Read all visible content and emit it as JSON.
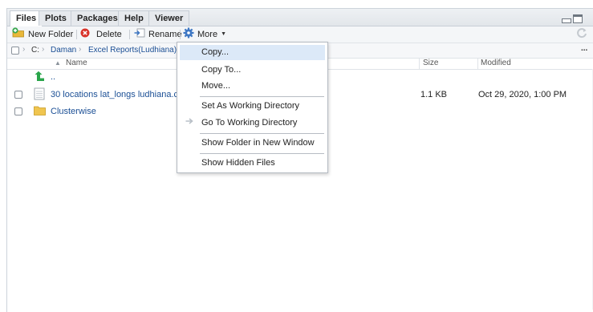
{
  "tabs": [
    "Files",
    "Plots",
    "Packages",
    "Help",
    "Viewer"
  ],
  "toolbar": {
    "new_folder": "New Folder",
    "delete": "Delete",
    "rename": "Rename",
    "more": "More"
  },
  "path": {
    "root": "C:",
    "crumbs": [
      "Daman",
      "Excel Reports(Ludhiana)"
    ],
    "more_label": "..."
  },
  "columns": {
    "name": "Name",
    "size": "Size",
    "modified": "Modified"
  },
  "files": {
    "parent": "..",
    "rows": [
      {
        "name": "30 locations lat_longs ludhiana.csv",
        "size": "1.1 KB",
        "modified": "Oct 29, 2020, 1:00 PM",
        "type": "file"
      },
      {
        "name": "Clusterwise",
        "size": "",
        "modified": "",
        "type": "folder"
      }
    ]
  },
  "menu": {
    "items": [
      {
        "label": "Copy...",
        "highlighted": true
      },
      {
        "label": "Copy To..."
      },
      {
        "label": "Move..."
      },
      {
        "label": "Set As Working Directory"
      },
      {
        "label": "Go To Working Directory"
      },
      {
        "label": "Show Folder in New Window"
      },
      {
        "label": "Show Hidden Files"
      }
    ]
  },
  "colors": {
    "link": "#1b4f95",
    "menu_highlight": "#dce9f8",
    "delete_icon": "#d9342b",
    "new_folder_icon": "#e9b83a",
    "more_icon": "#3f78c4",
    "up_arrow": "#2aa54a"
  }
}
